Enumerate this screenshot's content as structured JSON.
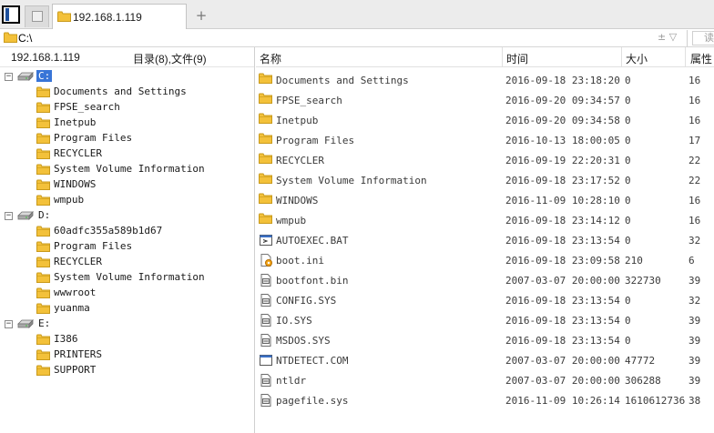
{
  "tabbar": {
    "active_tab": "192.168.1.119",
    "add_label": "+"
  },
  "address": {
    "value": "C:\\",
    "controls": "± ▽",
    "read_label": "读"
  },
  "left": {
    "host": "192.168.1.119",
    "counts": "目录(8),文件(9)",
    "drives": [
      {
        "label": "C:",
        "expanded": "−",
        "selected": true,
        "folders": [
          "Documents and Settings",
          "FPSE_search",
          "Inetpub",
          "Program Files",
          "RECYCLER",
          "System Volume Information",
          "WINDOWS",
          "wmpub"
        ]
      },
      {
        "label": "D:",
        "expanded": "−",
        "selected": false,
        "folders": [
          "60adfc355a589b1d67",
          "Program Files",
          "RECYCLER",
          "System Volume Information",
          "wwwroot",
          "yuanma"
        ]
      },
      {
        "label": "E:",
        "expanded": "−",
        "selected": false,
        "folders": [
          "I386",
          "PRINTERS",
          "SUPPORT"
        ]
      }
    ]
  },
  "right": {
    "columns": {
      "name": "名称",
      "time": "时间",
      "size": "大小",
      "attr": "属性"
    },
    "rows": [
      {
        "icon": "folder-icon",
        "name": "Documents and Settings",
        "time": "2016-09-18 23:18:20",
        "size": "0",
        "attr": "16"
      },
      {
        "icon": "folder-icon",
        "name": "FPSE_search",
        "time": "2016-09-20 09:34:57",
        "size": "0",
        "attr": "16"
      },
      {
        "icon": "folder-icon",
        "name": "Inetpub",
        "time": "2016-09-20 09:34:58",
        "size": "0",
        "attr": "16"
      },
      {
        "icon": "folder-icon",
        "name": "Program Files",
        "time": "2016-10-13 18:00:05",
        "size": "0",
        "attr": "17"
      },
      {
        "icon": "folder-icon",
        "name": "RECYCLER",
        "time": "2016-09-19 22:20:31",
        "size": "0",
        "attr": "22"
      },
      {
        "icon": "folder-icon",
        "name": "System Volume Information",
        "time": "2016-09-18 23:17:52",
        "size": "0",
        "attr": "22"
      },
      {
        "icon": "folder-icon",
        "name": "WINDOWS",
        "time": "2016-11-09 10:28:10",
        "size": "0",
        "attr": "16"
      },
      {
        "icon": "folder-icon",
        "name": "wmpub",
        "time": "2016-09-18 23:14:12",
        "size": "0",
        "attr": "16"
      },
      {
        "icon": "batch-file-icon",
        "name": "AUTOEXEC.BAT",
        "time": "2016-09-18 23:13:54",
        "size": "0",
        "attr": "32"
      },
      {
        "icon": "settings-file-icon",
        "name": "boot.ini",
        "time": "2016-09-18 23:09:58",
        "size": "210",
        "attr": "6"
      },
      {
        "icon": "system-file-icon",
        "name": "bootfont.bin",
        "time": "2007-03-07 20:00:00",
        "size": "322730",
        "attr": "39"
      },
      {
        "icon": "system-file-icon",
        "name": "CONFIG.SYS",
        "time": "2016-09-18 23:13:54",
        "size": "0",
        "attr": "32"
      },
      {
        "icon": "system-file-icon",
        "name": "IO.SYS",
        "time": "2016-09-18 23:13:54",
        "size": "0",
        "attr": "39"
      },
      {
        "icon": "system-file-icon",
        "name": "MSDOS.SYS",
        "time": "2016-09-18 23:13:54",
        "size": "0",
        "attr": "39"
      },
      {
        "icon": "program-file-icon",
        "name": "NTDETECT.COM",
        "time": "2007-03-07 20:00:00",
        "size": "47772",
        "attr": "39"
      },
      {
        "icon": "system-file-icon",
        "name": "ntldr",
        "time": "2007-03-07 20:00:00",
        "size": "306288",
        "attr": "39"
      },
      {
        "icon": "system-file-icon",
        "name": "pagefile.sys",
        "time": "2016-11-09 10:26:14",
        "size": "1610612736",
        "attr": "38"
      }
    ]
  },
  "colors": {
    "folder": "#f3c13a",
    "folder_edge": "#c99a1a",
    "selection": "#3875d7",
    "accent": "#1d4f9c"
  }
}
